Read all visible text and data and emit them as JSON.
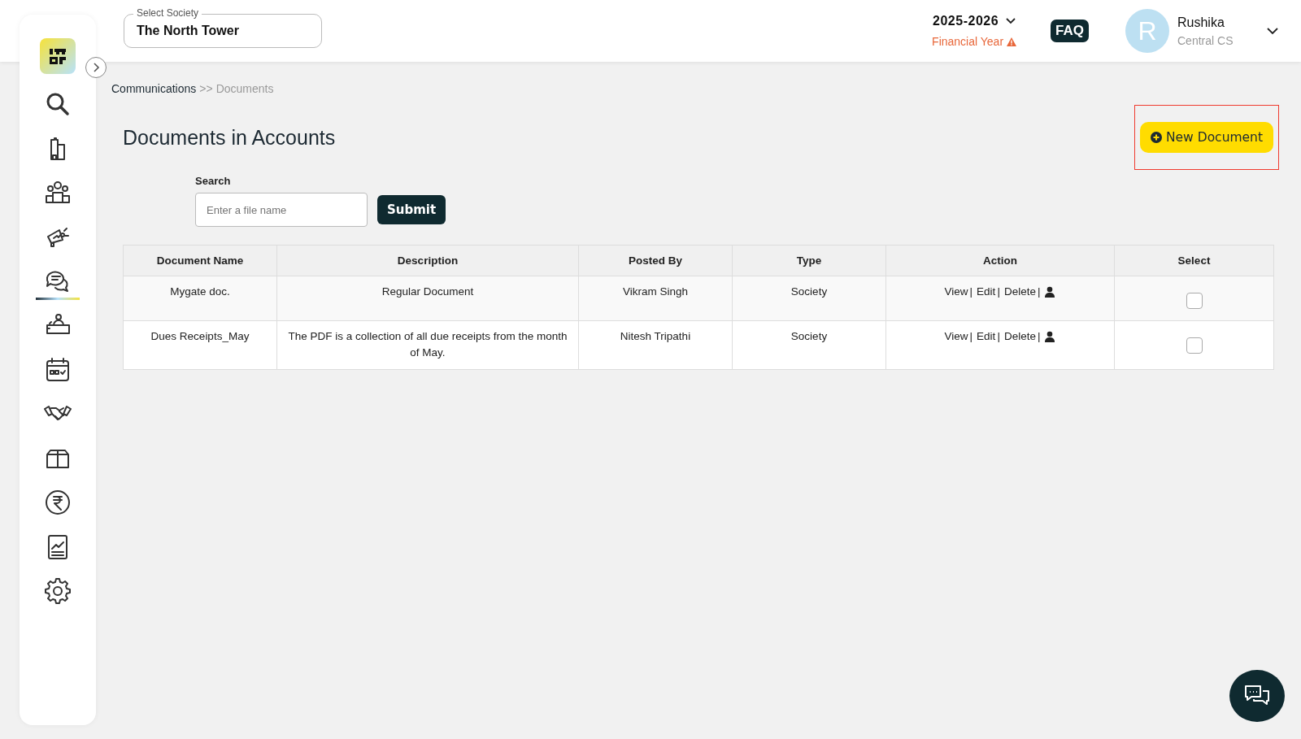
{
  "header": {
    "society": {
      "label": "Select Society",
      "value": "The North Tower"
    },
    "year": {
      "value": "2025-2026",
      "label": "Financial Year"
    },
    "faq": "FAQ",
    "user": {
      "initial": "R",
      "name": "Rushika",
      "role": "Central CS"
    }
  },
  "sidebar": {
    "items": [
      {
        "kind": "search",
        "selected": false
      },
      {
        "kind": "building",
        "selected": false
      },
      {
        "kind": "people",
        "selected": false
      },
      {
        "kind": "megaphone",
        "selected": false
      },
      {
        "kind": "chat",
        "selected": true
      },
      {
        "kind": "desk",
        "selected": false
      },
      {
        "kind": "calendar",
        "selected": false
      },
      {
        "kind": "handshake",
        "selected": false
      },
      {
        "kind": "box",
        "selected": false
      },
      {
        "kind": "rupee",
        "selected": false
      },
      {
        "kind": "report",
        "selected": false
      },
      {
        "kind": "settings",
        "selected": false
      }
    ]
  },
  "breadcrumb": {
    "parent": "Communications",
    "sep": ">>",
    "current": "Documents"
  },
  "title": "Documents in Accounts",
  "new_button": {
    "label": "New Document",
    "highlighted": true
  },
  "search": {
    "label": "Search",
    "placeholder": "Enter a file name",
    "button": "Submit"
  },
  "table": {
    "columns": [
      "Document Name",
      "Description",
      "Posted By",
      "Type",
      "Action",
      "Select"
    ],
    "rows": [
      {
        "name": "Mygate doc.",
        "description": "Regular Document",
        "posted_by": "Vikram Singh",
        "type": "Society",
        "actions": [
          {
            "label": "View",
            "sep": "|"
          },
          {
            "label": "Edit",
            "sep": "|"
          },
          {
            "label": "Delete",
            "sep": "|"
          }
        ],
        "checked": false
      },
      {
        "name": "Dues Receipts_May",
        "description": "The PDF is a collection of all due receipts from the month of May.",
        "posted_by": "Nitesh Tripathi",
        "type": "Society",
        "actions": [
          {
            "label": "View",
            "sep": "|"
          },
          {
            "label": "Edit",
            "sep": "|"
          },
          {
            "label": "Delete",
            "sep": "|"
          }
        ],
        "checked": false
      }
    ]
  }
}
